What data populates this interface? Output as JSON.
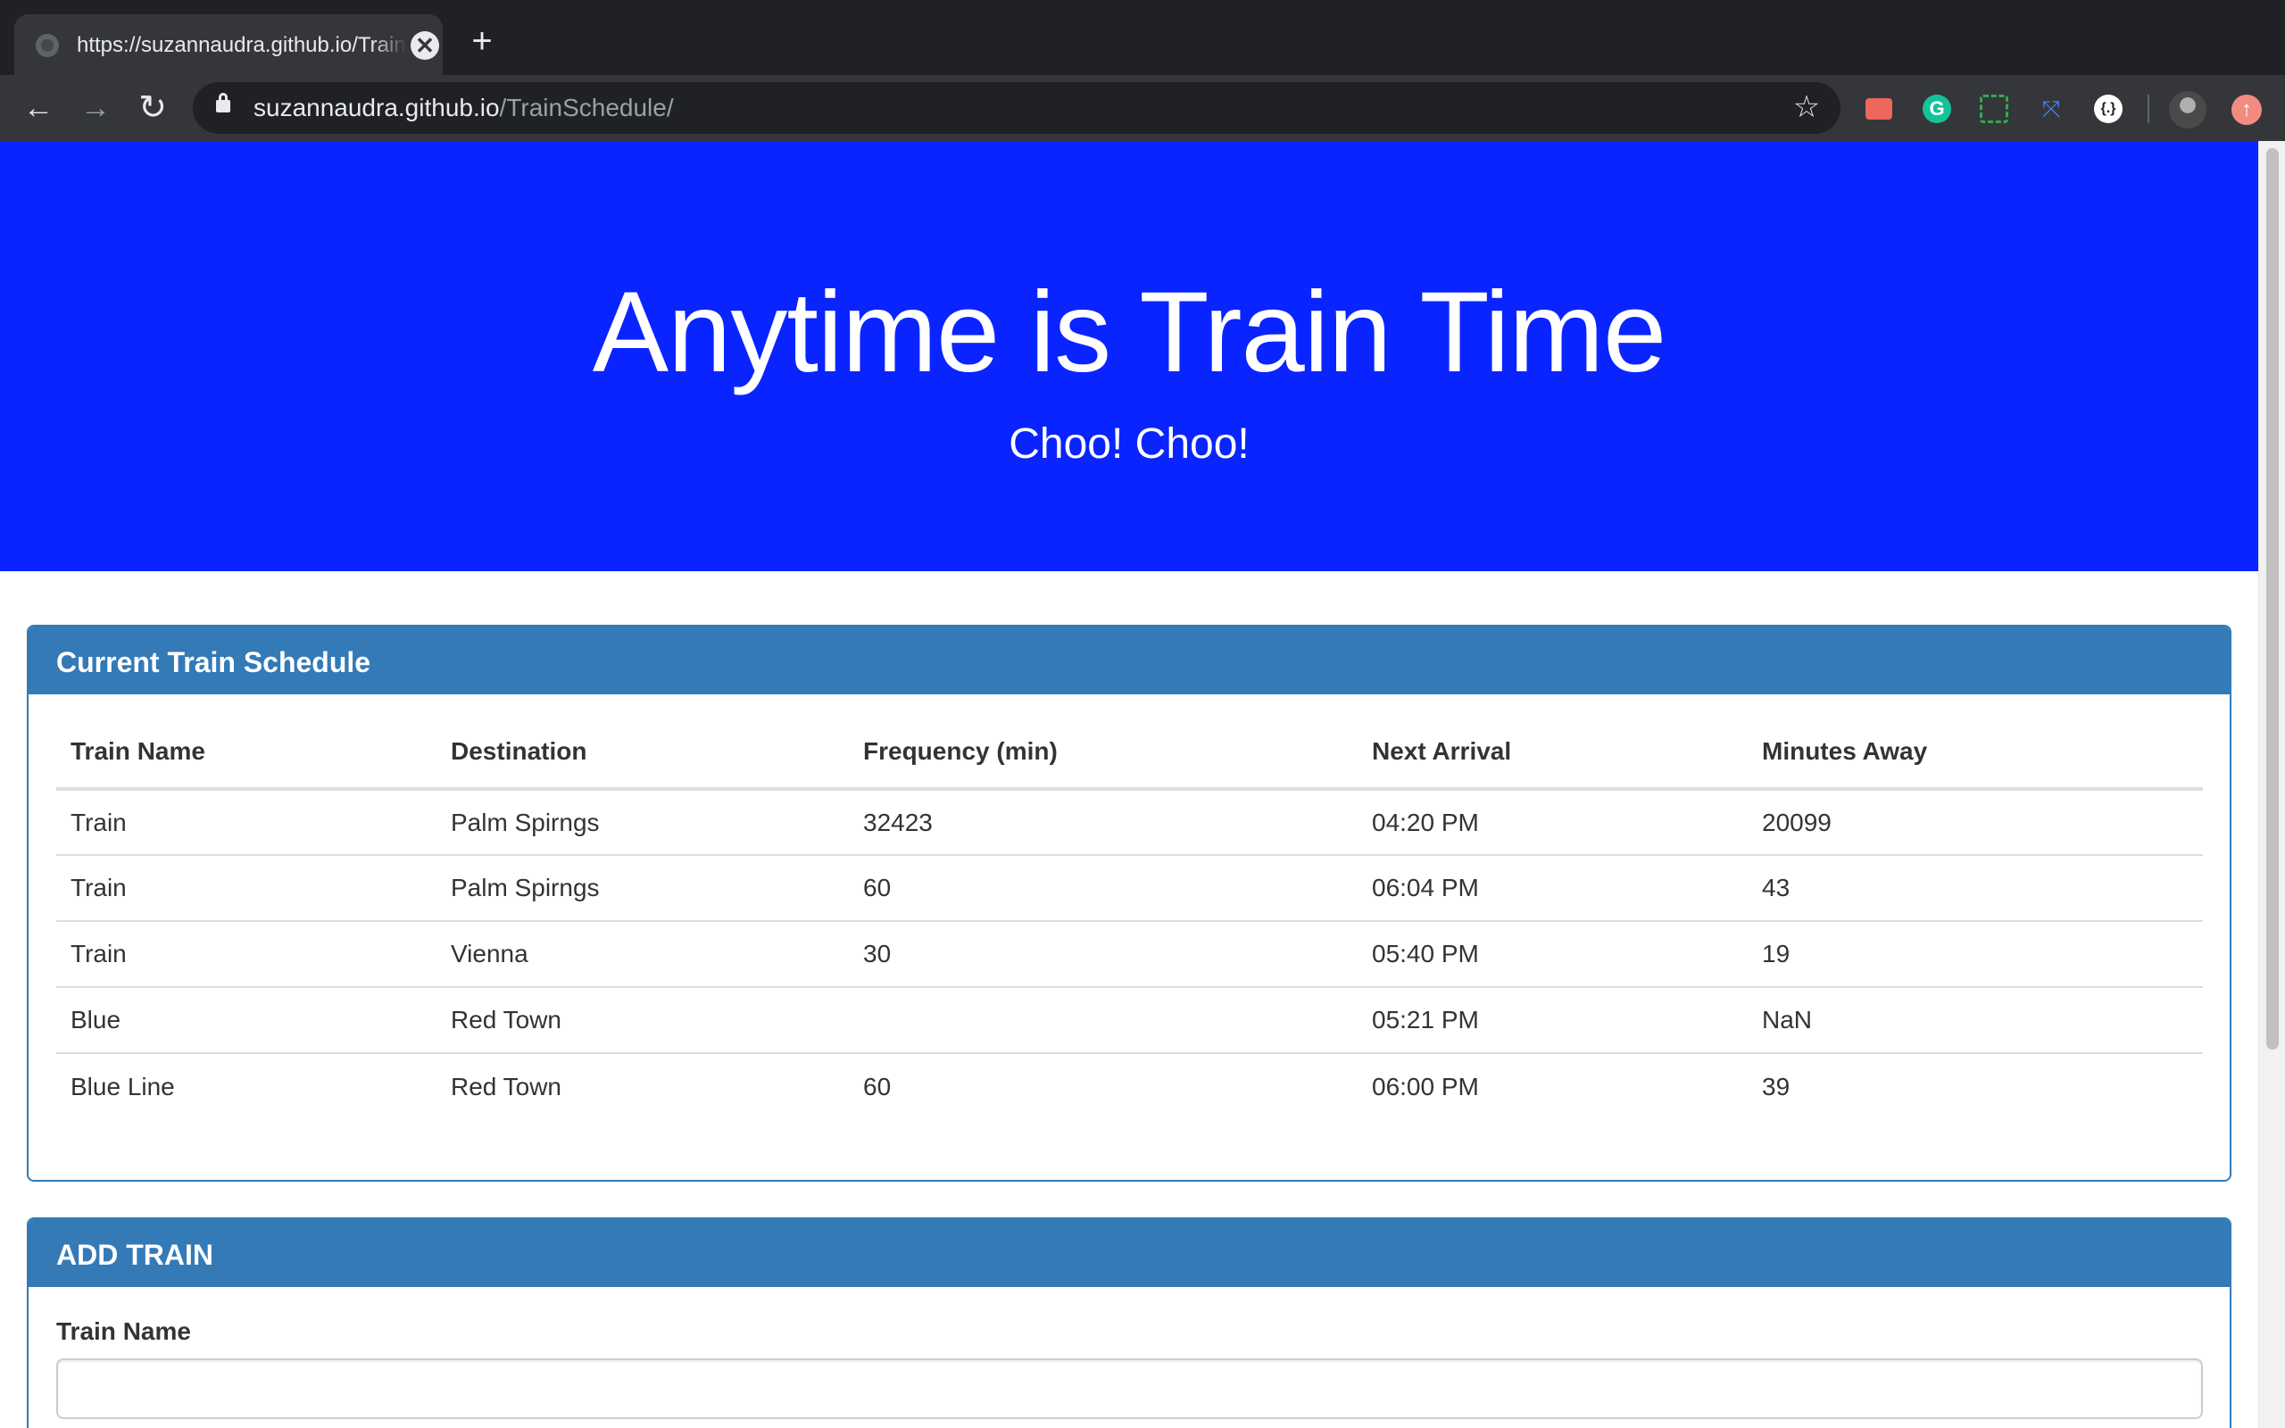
{
  "browser": {
    "tab_title": "https://suzannaudra.github.io/TrainSchedule/",
    "url_host": "suzannaudra.github.io",
    "url_path": "/TrainSchedule/",
    "icons": {
      "back": "←",
      "forward": "→",
      "reload": "↻",
      "star": "☆",
      "close": "✕",
      "new_tab": "+",
      "grammarly": "G",
      "ext_dev": "{.}",
      "ext_link": "⤧",
      "update": "↑"
    }
  },
  "header": {
    "title": "Anytime is Train Time",
    "subtitle": "Choo! Choo!",
    "bg_color": "#0a24ff"
  },
  "schedule": {
    "heading": "Current Train Schedule",
    "columns": [
      "Train Name",
      "Destination",
      "Frequency (min)",
      "Next Arrival",
      "Minutes Away"
    ],
    "rows": [
      [
        "Train",
        "Palm Spirngs",
        "32423",
        "04:20 PM",
        "20099"
      ],
      [
        "Train",
        "Palm Spirngs",
        "60",
        "06:04 PM",
        "43"
      ],
      [
        "Train",
        "Vienna",
        "30",
        "05:40 PM",
        "19"
      ],
      [
        "Blue",
        "Red Town",
        "",
        "05:21 PM",
        "NaN"
      ],
      [
        "Blue Line",
        "Red Town",
        "60",
        "06:00 PM",
        "39"
      ]
    ]
  },
  "add_train": {
    "heading": "ADD TRAIN",
    "train_name_label": "Train Name",
    "train_name_value": ""
  },
  "colors": {
    "panel_primary": "#337ab7",
    "browser_dark": "#202124"
  }
}
